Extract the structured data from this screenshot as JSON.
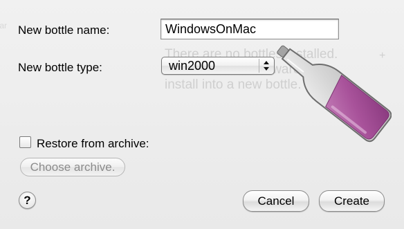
{
  "dialog": {
    "name_label": "New bottle name:",
    "name_value": "WindowsOnMac",
    "type_label": "New bottle type:",
    "type_selected": "win2000",
    "restore_label": "Restore from archive:",
    "restore_checked": false,
    "choose_archive_label": "Choose archive.",
    "cancel_label": "Cancel",
    "create_label": "Create",
    "help_label": "?"
  },
  "background_window": {
    "line1": "There are no bottles installed.",
    "line2": "Click                 ck install software to",
    "line3": "install into a new bottle.",
    "plus": "+",
    "left_fragment": "tar"
  },
  "icons": {
    "bottle": "wine-bottle-icon",
    "popup_arrows": "up-down-arrows-icon",
    "checkbox": "checkbox-unchecked-icon",
    "help": "help-icon"
  },
  "colors": {
    "wine": "#a8529a",
    "background": "#ececec"
  }
}
